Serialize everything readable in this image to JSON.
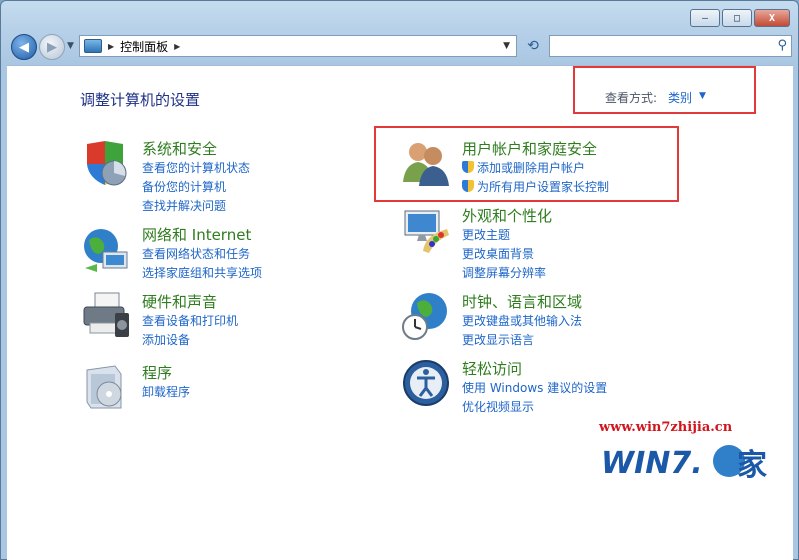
{
  "window": {
    "minimize": "—",
    "maximize": "□",
    "close": "X"
  },
  "nav": {
    "crumb": "控制面板",
    "search_placeholder": ""
  },
  "header": {
    "title": "调整计算机的设置",
    "view_label": "查看方式:",
    "view_value": "类别"
  },
  "categories": [
    {
      "title": "系统和安全",
      "icon": "system-security-icon",
      "links": [
        "查看您的计算机状态",
        "备份您的计算机",
        "查找并解决问题"
      ]
    },
    {
      "title": "网络和 Internet",
      "icon": "network-internet-icon",
      "links": [
        "查看网络状态和任务",
        "选择家庭组和共享选项"
      ]
    },
    {
      "title": "硬件和声音",
      "icon": "hardware-sound-icon",
      "links": [
        "查看设备和打印机",
        "添加设备"
      ]
    },
    {
      "title": "程序",
      "icon": "programs-icon",
      "links": [
        "卸载程序"
      ]
    },
    {
      "title": "用户帐户和家庭安全",
      "icon": "user-accounts-icon",
      "links": [
        "添加或删除用户帐户",
        "为所有用户设置家长控制"
      ]
    },
    {
      "title": "外观和个性化",
      "icon": "appearance-icon",
      "links": [
        "更改主题",
        "更改桌面背景",
        "调整屏幕分辨率"
      ]
    },
    {
      "title": "时钟、语言和区域",
      "icon": "clock-language-icon",
      "links": [
        "更改键盘或其他输入法",
        "更改显示语言"
      ]
    },
    {
      "title": "轻松访问",
      "icon": "ease-of-access-icon",
      "links": [
        "使用 Windows 建议的设置",
        "优化视频显示"
      ]
    }
  ],
  "watermark": {
    "url": "www.win7zhijia.cn",
    "logo_text": "WIN7.",
    "logo_char": "家"
  }
}
